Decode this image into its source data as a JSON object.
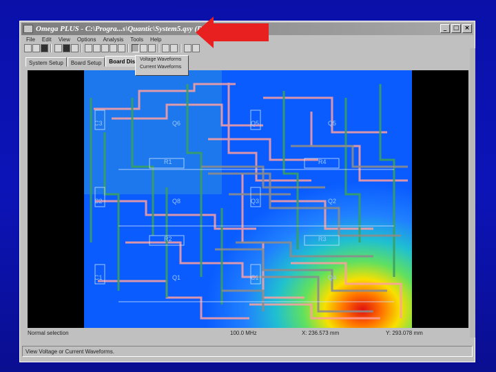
{
  "window": {
    "title": "Omega PLUS - C:\\Progra...s\\Quantic\\System5.qsy (Demo  w.xml)",
    "buttons": {
      "minimize": "_",
      "maximize": "□",
      "close": "×"
    }
  },
  "menu": [
    "File",
    "Edit",
    "View",
    "Options",
    "Analysis",
    "Tools",
    "Help"
  ],
  "tabs": [
    "System Setup",
    "Board Setup",
    "Board Disp"
  ],
  "dropdown": [
    "Voltage Waveforms",
    "Current Waveforms"
  ],
  "status": {
    "left": "Normal selection",
    "freq": "100.0 MHz",
    "x": "X: 236.573 mm",
    "y": "Y: 293.078 mm"
  },
  "hint": "View Voltage or Current Waveforms.",
  "board_labels": [
    "C3",
    "Q6",
    "Q5",
    "Q5",
    "R1",
    "R4",
    "C2",
    "Q8",
    "Q3",
    "Q2",
    "R2",
    "R3",
    "C1",
    "Q1",
    "C1",
    "Q4"
  ],
  "colors": {
    "accent_arrow": "#e82020",
    "board_bg": "#0a5cff"
  }
}
